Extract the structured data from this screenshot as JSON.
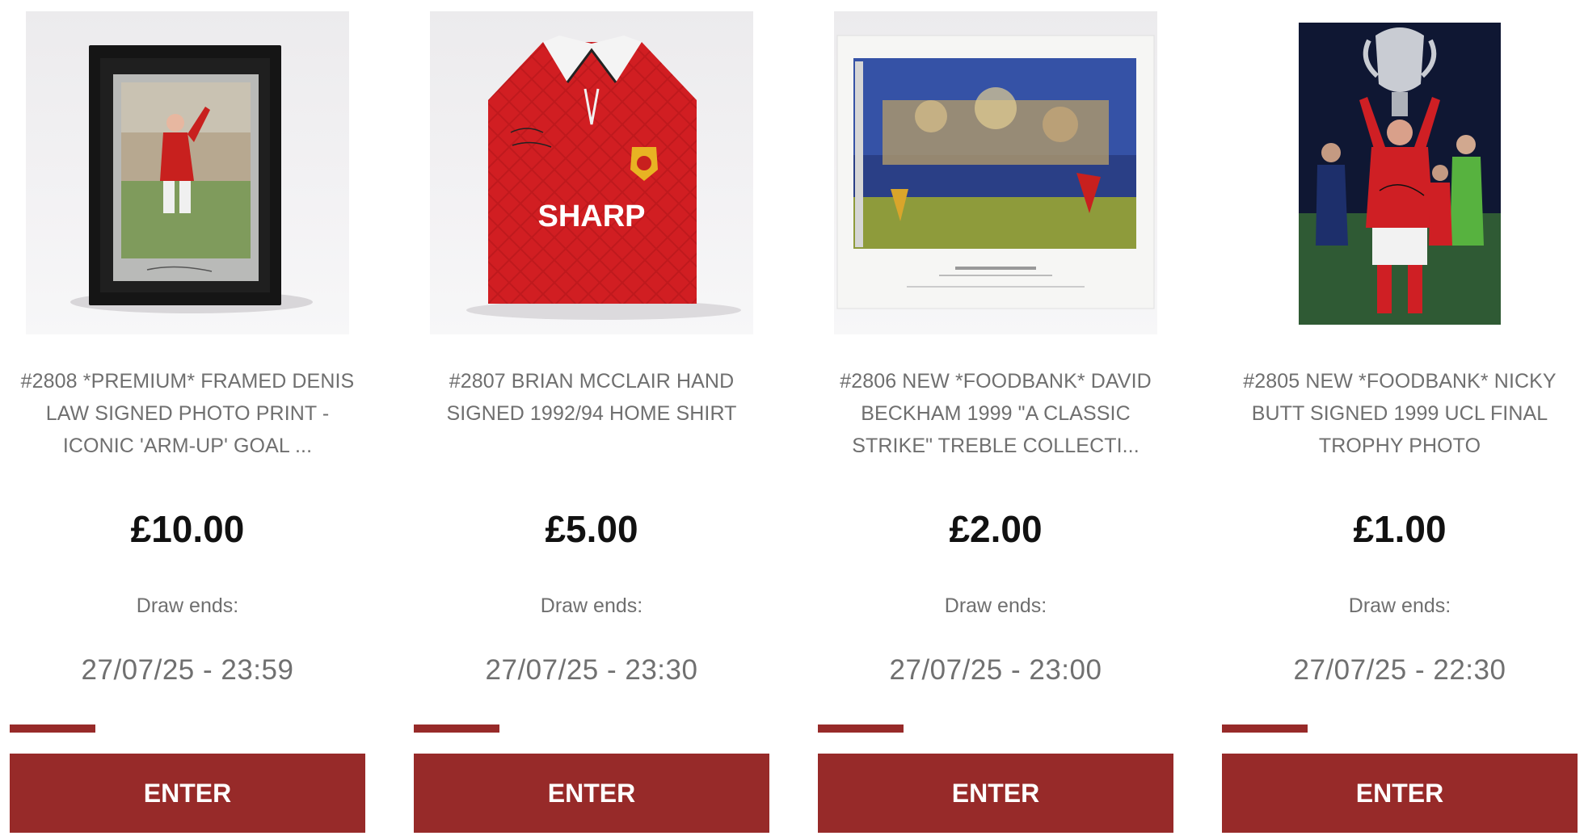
{
  "competitions": [
    {
      "image_alt": "Framed Denis Law signed photo print",
      "title": "#2808 *PREMIUM* FRAMED DENIS LAW SIGNED PHOTO PRINT - ICONIC 'ARM-UP' GOAL ...",
      "price": "£10.00",
      "draw_label": "Draw ends:",
      "draw_date": "27/07/25 - 23:59",
      "progress": 0.24,
      "button_label": "ENTER"
    },
    {
      "image_alt": "Brian McClair signed home shirt",
      "shirt_sponsor": "SHARP",
      "title": "#2807 BRIAN MCCLAIR HAND SIGNED 1992/94 HOME SHIRT",
      "price": "£5.00",
      "draw_label": "Draw ends:",
      "draw_date": "27/07/25 - 23:30",
      "progress": 0.24,
      "button_label": "ENTER"
    },
    {
      "image_alt": "David Beckham A Classic Strike print",
      "title": "#2806 NEW *FOODBANK* DAVID BECKHAM 1999 \"A CLASSIC STRIKE\" TREBLE COLLECTI...",
      "price": "£2.00",
      "draw_label": "Draw ends:",
      "draw_date": "27/07/25 - 23:00",
      "progress": 0.24,
      "button_label": "ENTER"
    },
    {
      "image_alt": "Nicky Butt 1999 UCL final trophy photo",
      "title": "#2805 NEW *FOODBANK* NICKY BUTT SIGNED 1999 UCL FINAL TROPHY PHOTO",
      "price": "£1.00",
      "draw_label": "Draw ends:",
      "draw_date": "27/07/25 - 22:30",
      "progress": 0.24,
      "button_label": "ENTER"
    }
  ],
  "colors": {
    "accent": "#972a29",
    "price": "#111111",
    "text": "#6f6f6f"
  }
}
